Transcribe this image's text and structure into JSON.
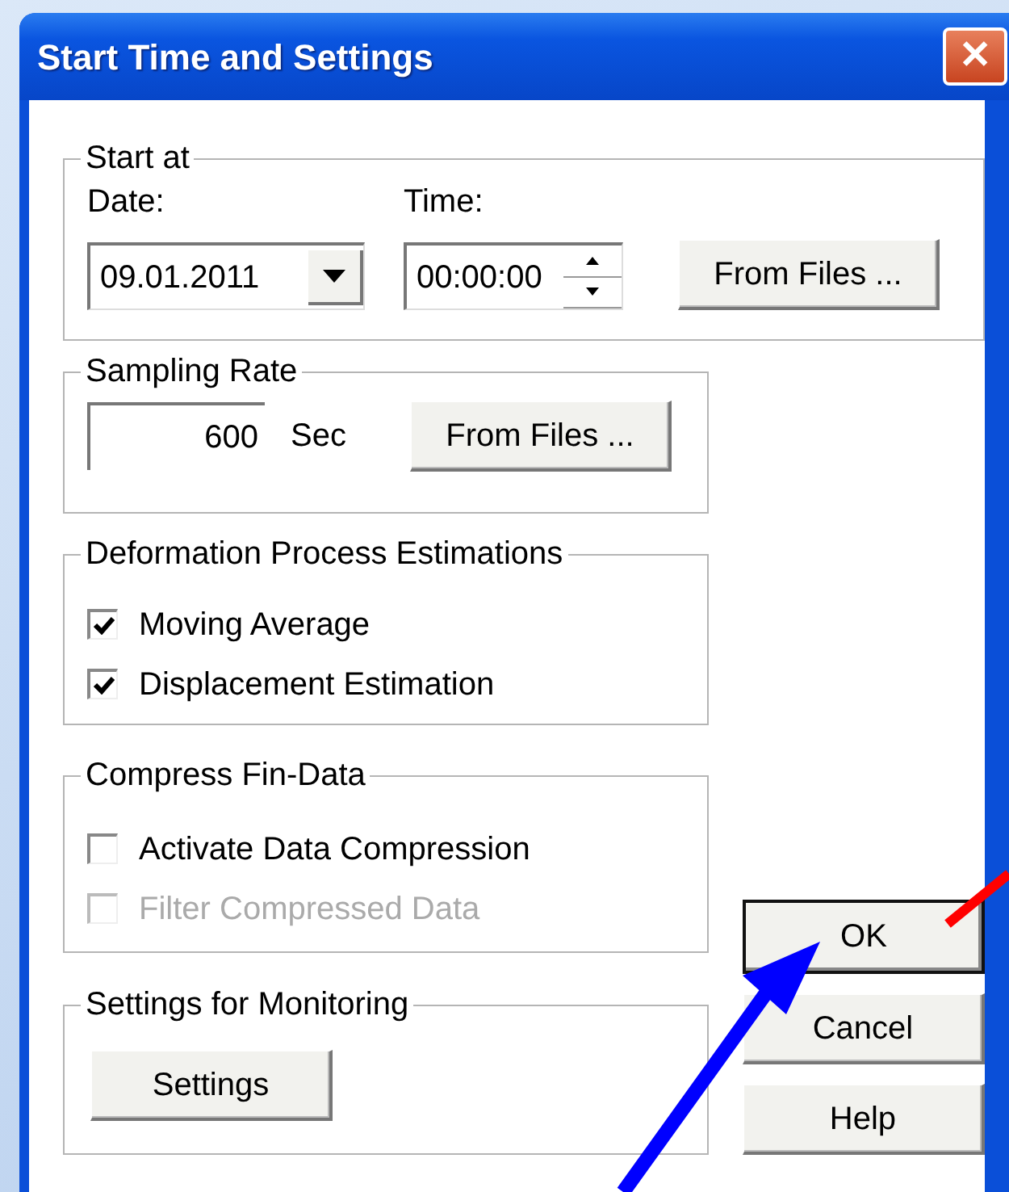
{
  "window": {
    "title": "Start Time and Settings",
    "close": "✕"
  },
  "start_at": {
    "label": "Start at",
    "date_label": "Date:",
    "date": "09.01.2011",
    "time_label": "Time:",
    "time": "00:00:00",
    "button": "From Files ..."
  },
  "sampling_rate": {
    "label": "Sampling Rate",
    "value": "600",
    "unit": "Sec",
    "button": "From Files ..."
  },
  "deformation": {
    "label": "Deformation Process Estimations",
    "options": [
      {
        "label": "Moving Average",
        "checked": true,
        "disabled": false
      },
      {
        "label": "Displacement Estimation",
        "checked": true,
        "disabled": false
      }
    ]
  },
  "compress": {
    "label": "Compress Fin-Data",
    "options": [
      {
        "label": "Activate Data Compression",
        "checked": false,
        "disabled": false
      },
      {
        "label": "Filter Compressed Data",
        "checked": false,
        "disabled": true
      }
    ]
  },
  "monitoring": {
    "label": "Settings for Monitoring",
    "button": "Settings"
  },
  "buttons": [
    {
      "label": "OK",
      "default": true
    },
    {
      "label": "Cancel",
      "default": false
    },
    {
      "label": "Help",
      "default": false
    }
  ],
  "annotations": [
    {
      "kind": "line",
      "color": "#ff0000"
    },
    {
      "kind": "arrow",
      "color": "#0000ff"
    }
  ]
}
